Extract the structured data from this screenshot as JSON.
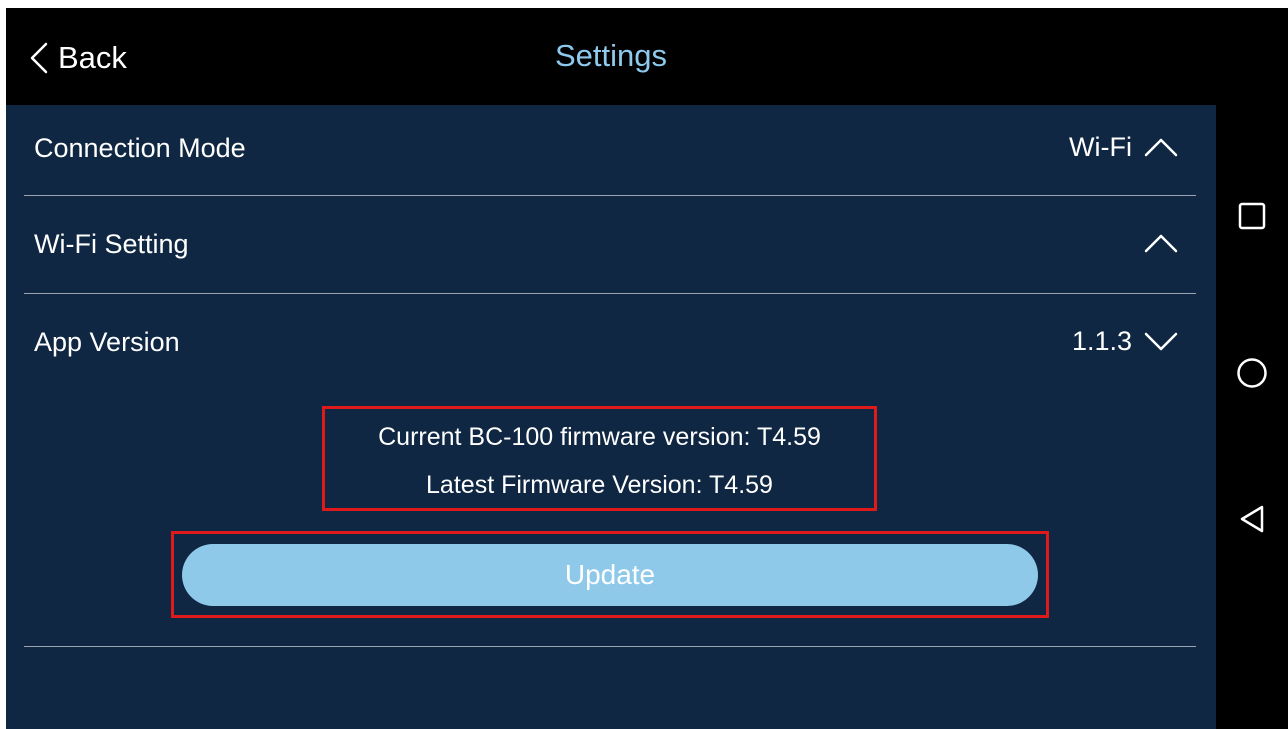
{
  "header": {
    "back_label": "Back",
    "title": "Settings"
  },
  "rows": [
    {
      "label": "Connection Mode",
      "value": "Wi-Fi",
      "chevron": "chevron-up-icon"
    },
    {
      "label": "Wi-Fi Setting",
      "value": "",
      "chevron": "chevron-up-icon"
    },
    {
      "label": "App Version",
      "value": "1.1.3",
      "chevron": "chevron-down-icon"
    }
  ],
  "firmware": {
    "current": "Current BC-100 firmware version: T4.59",
    "latest": "Latest Firmware Version: T4.59"
  },
  "update_label": "Update",
  "navbar": {
    "icons": [
      "recent-apps-icon",
      "home-icon",
      "back-triangle-icon"
    ]
  },
  "colors": {
    "background": "#0f2742",
    "title": "#8ec9ee",
    "button": "#8ec9ea",
    "highlight": "#e01a1a"
  }
}
